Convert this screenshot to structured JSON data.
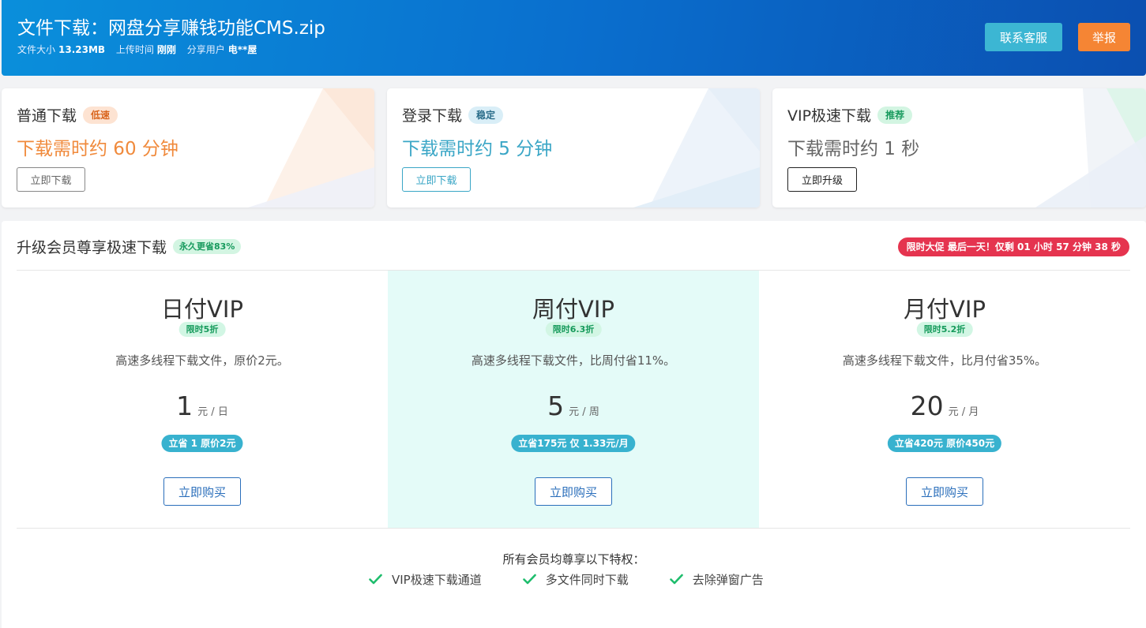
{
  "header": {
    "title": "文件下载：网盘分享赚钱功能CMS.zip",
    "size_label": "文件大小",
    "size_value": "13.23MB",
    "upload_label": "上传时间",
    "upload_value": "刚刚",
    "user_label": "分享用户",
    "user_value": "电**屋",
    "contact_button": "联系客服",
    "report_button": "举报"
  },
  "download_options": [
    {
      "name": "普通下载",
      "badge": "低速",
      "time": "下载需时约 60 分钟",
      "button": "立即下载",
      "colors": {
        "time": "#f08a3c",
        "badge_bg": "#fde3d2",
        "badge_text": "#d9641c",
        "button_border": "#888888",
        "button_text": "#666666",
        "deco": "#fdeee3"
      }
    },
    {
      "name": "登录下载",
      "badge": "稳定",
      "time": "下载需时约 5 分钟",
      "button": "立即下载",
      "colors": {
        "time": "#3aa6c6",
        "badge_bg": "#d9eef7",
        "badge_text": "#2a6d8a",
        "button_border": "#3aa6c6",
        "button_text": "#3aa6c6",
        "deco": "#e3eef7"
      }
    },
    {
      "name": "VIP极速下载",
      "badge": "推荐",
      "time": "下载需时约 1 秒",
      "button": "立即升级",
      "colors": {
        "time": "#666666",
        "badge_bg": "#d3f5e2",
        "badge_text": "#179a5d",
        "button_border": "#222222",
        "button_text": "#222222",
        "deco": "#dff5ea"
      }
    }
  ],
  "vip": {
    "title": "升级会员尊享极速下载",
    "title_badge": "永久更省83%",
    "promo": "限时大促 最后一天！仅剩 01 小时 57 分钟 38 秒",
    "plans": [
      {
        "name": "日付VIP",
        "discount": "限时5折",
        "desc": "高速多线程下载文件，原价2元。",
        "price": "1",
        "unit": "元 / 日",
        "save": "立省 1 原价2元",
        "button": "立即购买"
      },
      {
        "name": "周付VIP",
        "discount": "限时6.3折",
        "desc": "高速多线程下载文件，比周付省11%。",
        "price": "5",
        "unit": "元 / 周",
        "save": "立省175元 仅 1.33元/月",
        "button": "立即购买"
      },
      {
        "name": "月付VIP",
        "discount": "限时5.2折",
        "desc": "高速多线程下载文件，比月付省35%。",
        "price": "20",
        "unit": "元 / 月",
        "save": "立省420元 原价450元",
        "button": "立即购买"
      }
    ],
    "perks_title": "所有会员均尊享以下特权：",
    "perks": [
      "VIP极速下载通道",
      "多文件同时下载",
      "去除弹窗广告"
    ],
    "perk_icon": "check-icon",
    "colors": {
      "highlight": "#e4fbf8",
      "check": "#1fbd6d",
      "promo": "#e5344f"
    }
  }
}
